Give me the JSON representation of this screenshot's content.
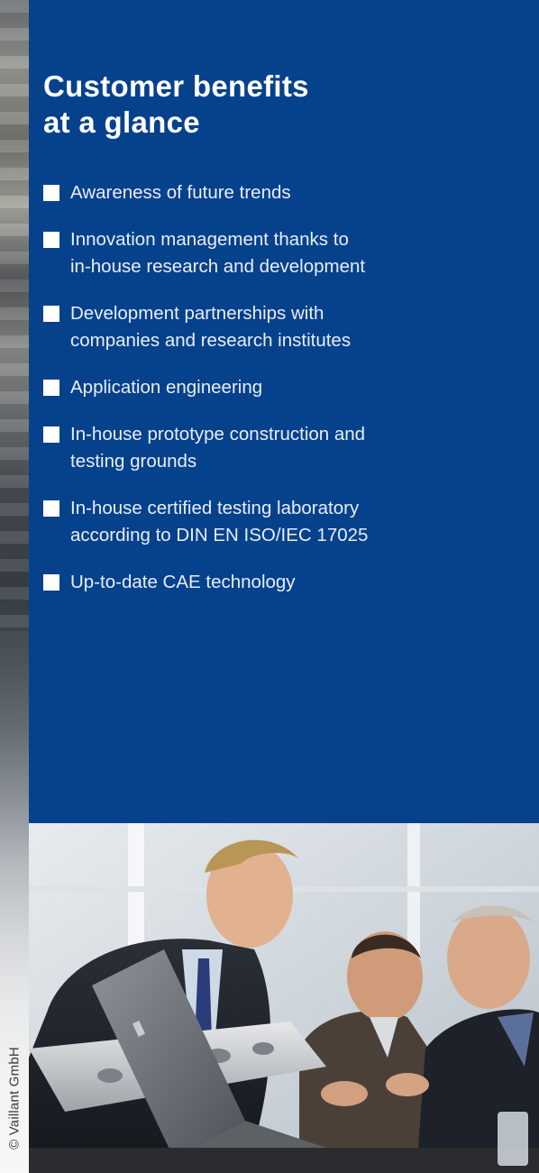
{
  "page": {
    "heading_line1": "Customer benefits",
    "heading_line2": "at a glance",
    "copyright": "© Vaillant GmbH"
  },
  "benefits": [
    {
      "line1": "Awareness of future trends",
      "line2": ""
    },
    {
      "line1": "Innovation management thanks to",
      "line2": "in-house research and development"
    },
    {
      "line1": "Development partnerships with",
      "line2": "companies and research institutes"
    },
    {
      "line1": "Application engineering",
      "line2": ""
    },
    {
      "line1": "In-house prototype construction and",
      "line2": "testing grounds"
    },
    {
      "line1": "In-house certified testing laboratory",
      "line2": "according to DIN EN ISO/IEC 17025"
    },
    {
      "line1": "Up-to-date CAE technology",
      "line2": ""
    }
  ],
  "colors": {
    "panel_blue": "#06418c",
    "text": "#ffffff"
  }
}
